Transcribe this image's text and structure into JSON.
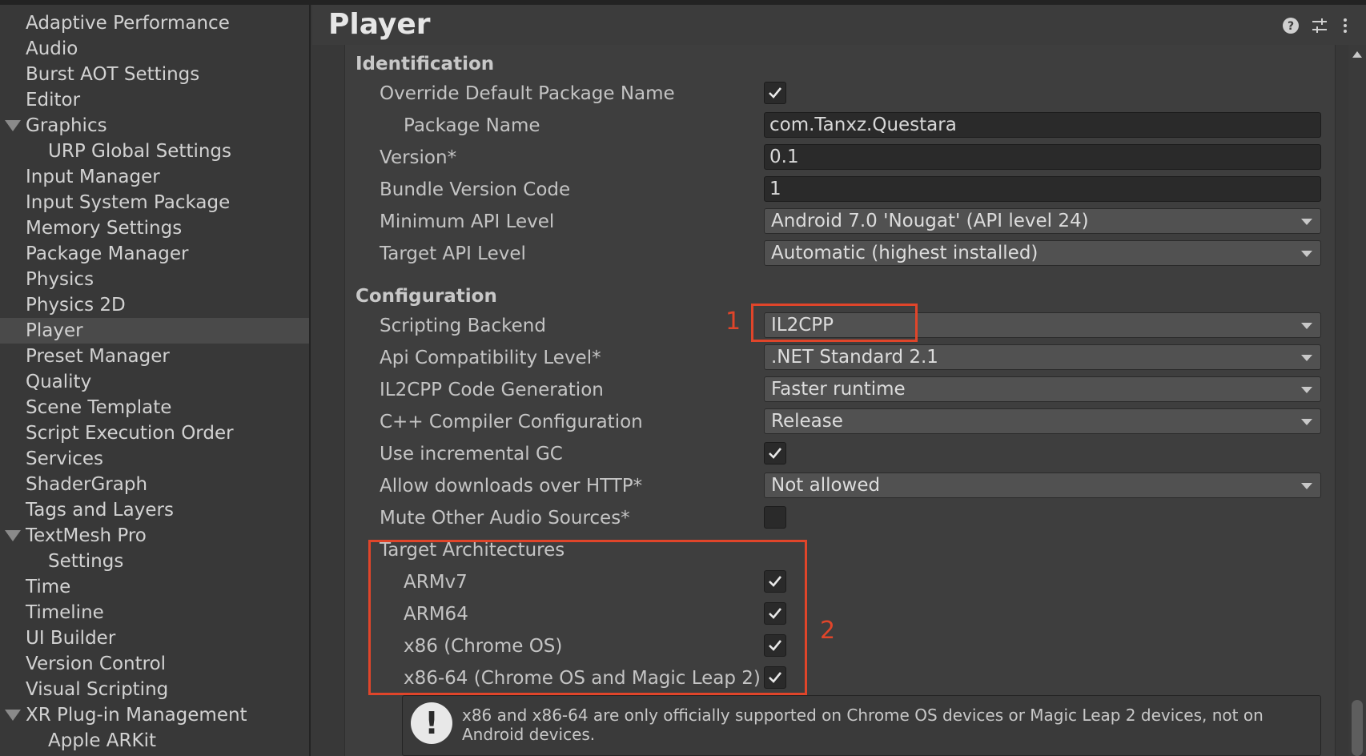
{
  "sidebar": {
    "items": [
      {
        "label": "Adaptive Performance"
      },
      {
        "label": "Audio"
      },
      {
        "label": "Burst AOT Settings"
      },
      {
        "label": "Editor"
      },
      {
        "label": "Graphics"
      },
      {
        "label": "URP Global Settings"
      },
      {
        "label": "Input Manager"
      },
      {
        "label": "Input System Package"
      },
      {
        "label": "Memory Settings"
      },
      {
        "label": "Package Manager"
      },
      {
        "label": "Physics"
      },
      {
        "label": "Physics 2D"
      },
      {
        "label": "Player"
      },
      {
        "label": "Preset Manager"
      },
      {
        "label": "Quality"
      },
      {
        "label": "Scene Template"
      },
      {
        "label": "Script Execution Order"
      },
      {
        "label": "Services"
      },
      {
        "label": "ShaderGraph"
      },
      {
        "label": "Tags and Layers"
      },
      {
        "label": "TextMesh Pro"
      },
      {
        "label": "Settings"
      },
      {
        "label": "Time"
      },
      {
        "label": "Timeline"
      },
      {
        "label": "UI Builder"
      },
      {
        "label": "Version Control"
      },
      {
        "label": "Visual Scripting"
      },
      {
        "label": "XR Plug-in Management"
      },
      {
        "label": "Apple ARKit"
      }
    ],
    "selected": "Player"
  },
  "header": {
    "title": "Player",
    "icons": [
      "help-icon",
      "preset-sliders-icon",
      "more-menu-icon"
    ]
  },
  "identification": {
    "section_label": "Identification",
    "override_package_name": {
      "label": "Override Default Package Name",
      "checked": true
    },
    "package_name": {
      "label": "Package Name",
      "value": "com.Tanxz.Questara"
    },
    "version": {
      "label": "Version*",
      "value": "0.1"
    },
    "bundle_version_code": {
      "label": "Bundle Version Code",
      "value": "1"
    },
    "min_api_level": {
      "label": "Minimum API Level",
      "value": "Android 7.0 'Nougat' (API level 24)"
    },
    "target_api_level": {
      "label": "Target API Level",
      "value": "Automatic (highest installed)"
    }
  },
  "configuration": {
    "section_label": "Configuration",
    "scripting_backend": {
      "label": "Scripting Backend",
      "value": "IL2CPP"
    },
    "api_compat": {
      "label": "Api Compatibility Level*",
      "value": ".NET Standard 2.1"
    },
    "il2cpp_codegen": {
      "label": "IL2CPP Code Generation",
      "value": "Faster runtime"
    },
    "cpp_compiler": {
      "label": "C++ Compiler Configuration",
      "value": "Release"
    },
    "incremental_gc": {
      "label": "Use incremental GC",
      "checked": true
    },
    "http_downloads": {
      "label": "Allow downloads over HTTP*",
      "value": "Not allowed"
    },
    "mute_audio": {
      "label": "Mute Other Audio Sources*",
      "checked": false
    },
    "target_arch": {
      "label": "Target Architectures",
      "armv7": {
        "label": "ARMv7",
        "checked": true
      },
      "arm64": {
        "label": "ARM64",
        "checked": true
      },
      "x86": {
        "label": "x86 (Chrome OS)",
        "checked": true
      },
      "x86_64": {
        "label": "x86-64 (Chrome OS and Magic Leap 2)",
        "checked": true
      }
    }
  },
  "annotations": {
    "marker1": "1",
    "marker2": "2",
    "color": "#e0452a"
  },
  "warning": {
    "text": "x86 and x86-64 are only officially supported on Chrome OS devices or Magic Leap 2 devices, not on Android devices."
  }
}
